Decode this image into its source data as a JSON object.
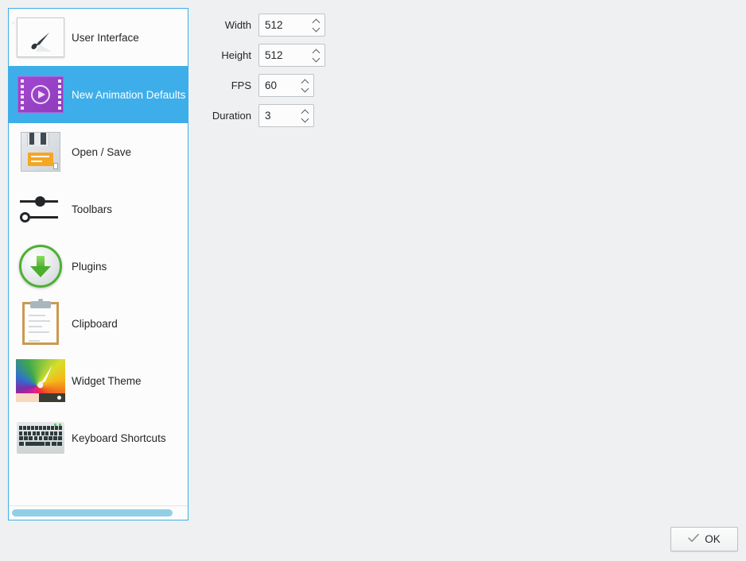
{
  "sidebar": {
    "scrollbar": {
      "name": "horizontal-scrollbar"
    },
    "items": [
      {
        "label": "User Interface",
        "icon": "user-interface-icon",
        "selected": false
      },
      {
        "label": "New Animation Defaults",
        "icon": "film-strip-play-icon",
        "selected": true
      },
      {
        "label": "Open / Save",
        "icon": "floppy-disk-icon",
        "selected": false
      },
      {
        "label": "Toolbars",
        "icon": "sliders-icon",
        "selected": false
      },
      {
        "label": "Plugins",
        "icon": "download-arrow-icon",
        "selected": false
      },
      {
        "label": "Clipboard",
        "icon": "clipboard-icon",
        "selected": false
      },
      {
        "label": "Widget Theme",
        "icon": "color-wheel-brush-icon",
        "selected": false
      },
      {
        "label": "Keyboard Shortcuts",
        "icon": "keyboard-icon",
        "selected": false
      }
    ]
  },
  "form": {
    "fields": [
      {
        "label": "Width",
        "value": "512",
        "width_class": "w-wide"
      },
      {
        "label": "Height",
        "value": "512",
        "width_class": "w-wide"
      },
      {
        "label": "FPS",
        "value": "60",
        "width_class": "w-narrow"
      },
      {
        "label": "Duration",
        "value": "3",
        "width_class": "w-narrow"
      }
    ]
  },
  "buttons": {
    "ok_label": "OK"
  },
  "colors": {
    "selection": "#3daee9",
    "background": "#eff0f1",
    "panel": "#fcfcfc",
    "text": "#232629",
    "scrollbar_thumb": "#93cee9"
  }
}
